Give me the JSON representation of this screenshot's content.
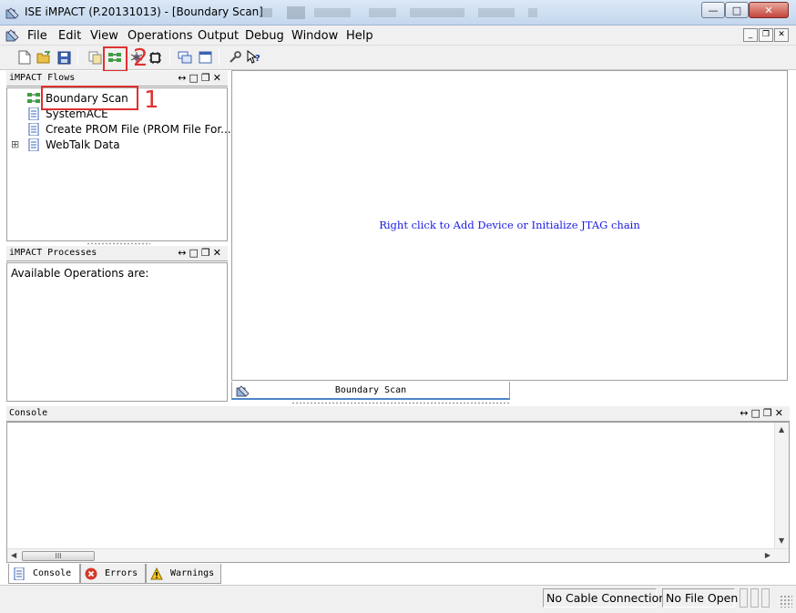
{
  "window": {
    "title": "ISE iMPACT (P.20131013) - [Boundary Scan]",
    "min_glyph": "—",
    "max_glyph": "□",
    "close_glyph": "✕"
  },
  "menu": {
    "items": [
      "File",
      "Edit",
      "View",
      "Operations",
      "Output",
      "Debug",
      "Window",
      "Help"
    ],
    "mdi_controls": [
      "_",
      "❐",
      "✕"
    ]
  },
  "flows_panel": {
    "title": "iMPACT Flows",
    "controls": "↔□❐✕",
    "items": [
      {
        "label": "Boundary Scan",
        "icon": "boundary-scan-icon"
      },
      {
        "label": "SystemACE",
        "icon": "document-icon"
      },
      {
        "label": "Create PROM File (PROM File For...",
        "icon": "document-icon"
      },
      {
        "label": "WebTalk Data",
        "icon": "document-icon",
        "expander": "⊞"
      }
    ]
  },
  "processes_panel": {
    "title": "iMPACT Processes",
    "controls": "↔□❐✕",
    "text": "Available Operations are:"
  },
  "main": {
    "hint": "Right click to Add Device or Initialize JTAG chain",
    "tab_label": "Boundary Scan"
  },
  "console": {
    "title": "Console",
    "controls": "↔□❐✕",
    "thumb_grip": "III",
    "tabs": [
      {
        "label": "Console",
        "icon": "console-icon"
      },
      {
        "label": "Errors",
        "icon": "error-icon"
      },
      {
        "label": "Warnings",
        "icon": "warning-icon"
      }
    ]
  },
  "annotations": {
    "one": "1",
    "two": "2"
  },
  "status": {
    "cable": "No Cable Connection",
    "file": "No File Open"
  },
  "colors": {
    "annotation_red": "#e03030",
    "hint_blue": "#1a1ae6",
    "tab_accent": "#4f86c6"
  }
}
